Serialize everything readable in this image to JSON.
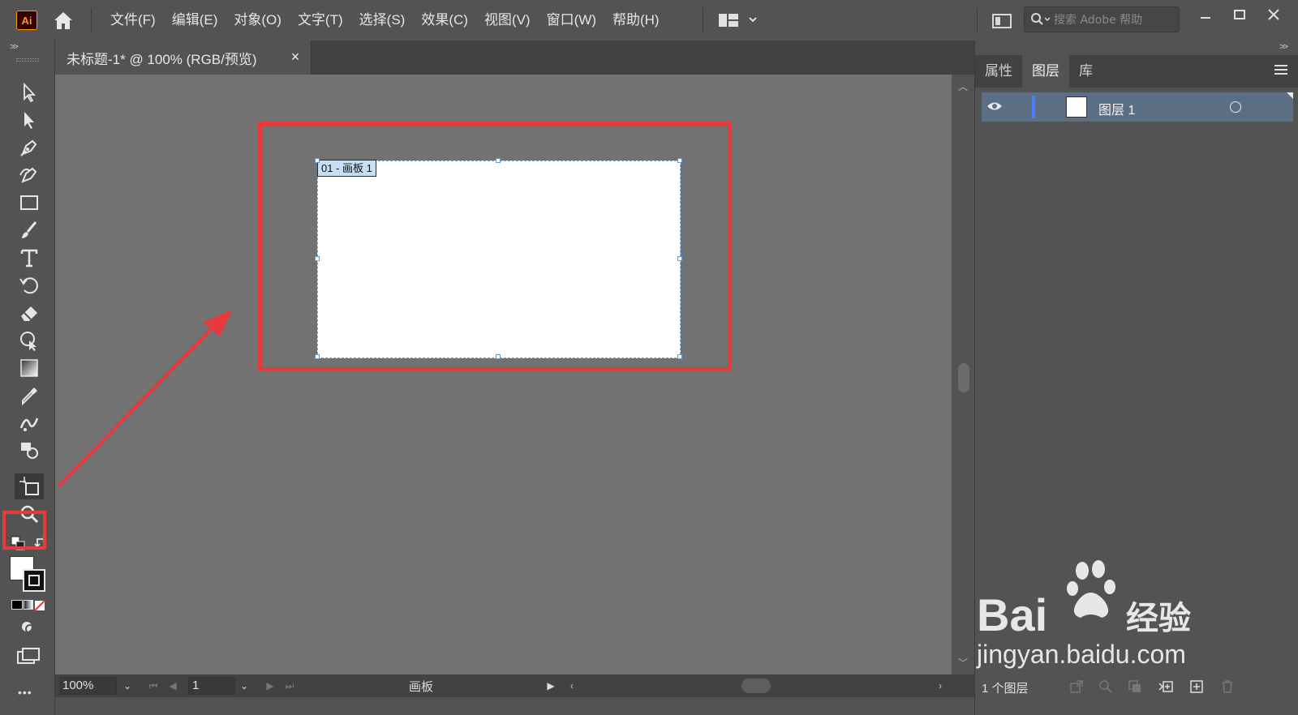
{
  "app": {
    "logo_text": "Ai"
  },
  "menu": [
    "文件(F)",
    "编辑(E)",
    "对象(O)",
    "文字(T)",
    "选择(S)",
    "效果(C)",
    "视图(V)",
    "窗口(W)",
    "帮助(H)"
  ],
  "search": {
    "placeholder": "搜索 Adobe 帮助"
  },
  "document_tab": {
    "title": "未标题-1* @ 100% (RGB/预览)",
    "close": "×"
  },
  "artboard": {
    "label": "01 - 画板 1"
  },
  "status": {
    "zoom": "100%",
    "page": "1",
    "tool_label": "画板"
  },
  "right_panel": {
    "tabs": [
      "属性",
      "图层",
      "库"
    ],
    "active_tab": "图层",
    "layers": [
      {
        "name": "图层 1"
      }
    ],
    "layer_count": "1 个图层"
  },
  "watermark": {
    "brand": "Bai",
    "brand_suffix": "经验",
    "url": "jingyan.baidu.com"
  },
  "colors": {
    "annotation": "#e8393c",
    "ui_bg": "#535353",
    "canvas": "#727272",
    "layer_highlight": "#5c6e83"
  }
}
